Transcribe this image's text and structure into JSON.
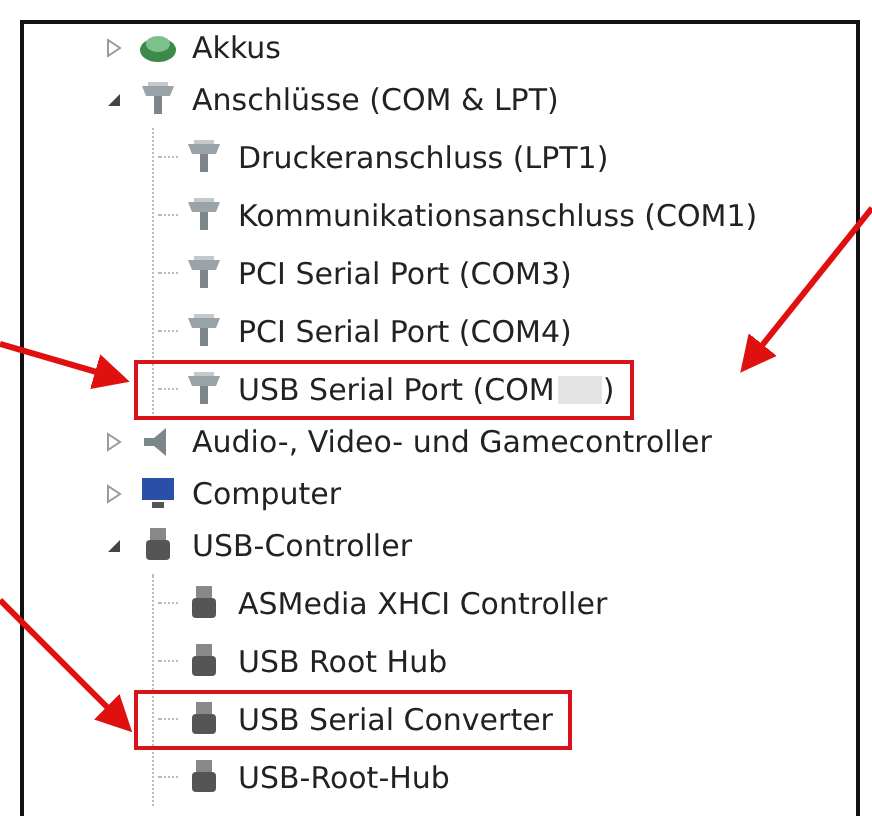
{
  "tree": [
    {
      "label": "Akkus",
      "kind": "battery",
      "expanded": false
    },
    {
      "label": "Anschlüsse (COM & LPT)",
      "kind": "port",
      "expanded": true,
      "children": [
        {
          "label": "Druckeranschluss (LPT1)",
          "kind": "port",
          "highlighted": false
        },
        {
          "label": "Kommunikationsanschluss (COM1)",
          "kind": "port",
          "highlighted": false
        },
        {
          "label": "PCI Serial Port (COM3)",
          "kind": "port",
          "highlighted": false
        },
        {
          "label": "PCI Serial Port (COM4)",
          "kind": "port",
          "highlighted": false
        },
        {
          "label": "USB Serial Port (COM",
          "suffix": ")",
          "redacted": true,
          "kind": "port",
          "highlighted": true
        }
      ]
    },
    {
      "label": "Audio-, Video- und Gamecontroller",
      "kind": "audio",
      "expanded": false
    },
    {
      "label": "Computer",
      "kind": "computer",
      "expanded": false
    },
    {
      "label": "USB-Controller",
      "kind": "usb",
      "expanded": true,
      "children": [
        {
          "label": "ASMedia XHCI Controller",
          "kind": "usb",
          "highlighted": false
        },
        {
          "label": "USB Root Hub",
          "kind": "usb",
          "highlighted": false
        },
        {
          "label": "USB Serial Converter",
          "kind": "usb",
          "highlighted": true
        },
        {
          "label": "USB-Root-Hub",
          "kind": "usb",
          "highlighted": false
        }
      ]
    }
  ]
}
